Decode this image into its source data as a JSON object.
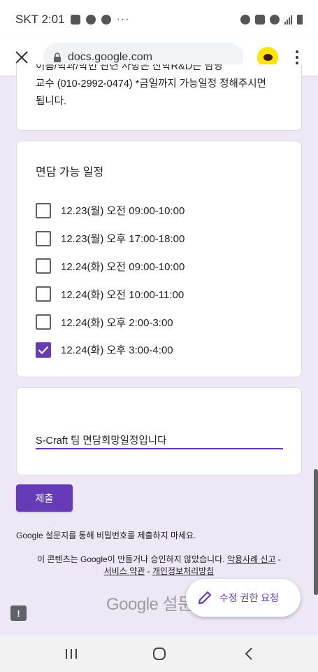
{
  "status_bar": {
    "carrier_time": "SKT 2:01",
    "more": "···"
  },
  "browser": {
    "url": "docs.google.com"
  },
  "description": {
    "line1": "이름/학과/학번 관련 사항은 산학R&D는 담당",
    "line2": "교수 (010-2992-0474) *금일까지 가능일정 정해주시면",
    "line3": "됩니다."
  },
  "question": {
    "title": "면담 가능 일정",
    "options": [
      {
        "label": "12.23(월) 오전 09:00-10:00",
        "checked": false
      },
      {
        "label": "12.23(월) 오후 17:00-18:00",
        "checked": false
      },
      {
        "label": "12.24(화) 오전 09:00-10:00",
        "checked": false
      },
      {
        "label": "12.24(화) 오전 10:00-11:00",
        "checked": false
      },
      {
        "label": "12.24(화) 오후 2:00-3:00",
        "checked": false
      },
      {
        "label": "12.24(화) 오후 3:00-4:00",
        "checked": true
      }
    ]
  },
  "answer": {
    "value": "S-Craft 팀 면담희망일정입니다"
  },
  "submit_label": "제출",
  "notice": "Google 설문지를 통해 비밀번호를 제출하지 마세요.",
  "disclaimer": {
    "text": "이 콘텐츠는 Google이 만들거나 승인하지 않았습니다.",
    "report_link": "악용사례 신고",
    "separator1": " -",
    "terms_link": "서비스 약관",
    "separator2": " - ",
    "privacy_link": "개인정보처리방침"
  },
  "footer_logo": "Google 설문",
  "fab_label": "수정 권한 요청",
  "feedback_label": "!",
  "colors": {
    "accent": "#673ab7",
    "page_bg": "#ede7f6",
    "kakao": "#fee500"
  }
}
